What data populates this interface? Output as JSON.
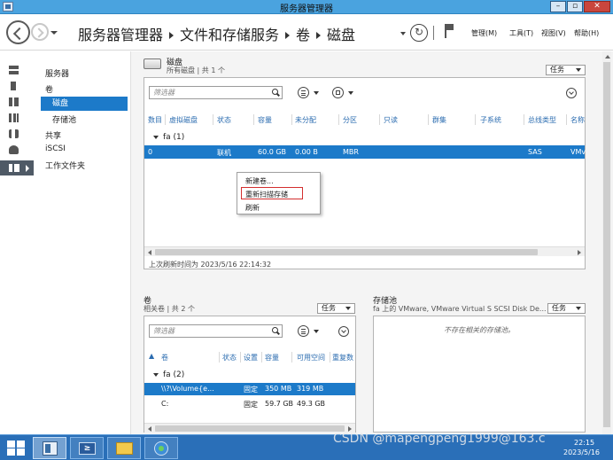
{
  "window": {
    "title": "服务器管理器",
    "min": "–",
    "max": "▫",
    "close": "✕"
  },
  "header": {
    "breadcrumb": [
      "服务器管理器",
      "文件和存储服务",
      "卷",
      "磁盘"
    ],
    "refresh": "↻",
    "menu": [
      "管理(M)",
      "工具(T)",
      "视图(V)",
      "帮助(H)"
    ]
  },
  "sidebar": {
    "items": [
      "服务器",
      "卷",
      "磁盘",
      "存储池",
      "共享",
      "iSCSI",
      "工作文件夹"
    ],
    "selected": "磁盘"
  },
  "disks": {
    "title": "磁盘",
    "subtitle": "所有磁盘 | 共 1 个",
    "tasks": "任务",
    "filter_placeholder": "筛选器",
    "columns": [
      "数目",
      "虚拟磁盘",
      "状态",
      "容量",
      "未分配",
      "分区",
      "只读",
      "群集",
      "子系统",
      "总线类型",
      "名称"
    ],
    "group": "fa (1)",
    "row": {
      "number": "0",
      "status": "联机",
      "capacity": "60.0 GB",
      "unallocated": "0.00 B",
      "partition": "MBR",
      "bus": "SAS",
      "name": "VMv"
    },
    "last_refresh": "上次刷新时间为 2023/5/16 22:14:32"
  },
  "context_menu": {
    "items": [
      "新建卷...",
      "重新扫描存储",
      "刷新"
    ],
    "highlighted": "重新扫描存储"
  },
  "volumes": {
    "title": "卷",
    "subtitle": "相关卷 | 共 2 个",
    "tasks": "任务",
    "filter_placeholder": "筛选器",
    "columns": [
      "卷",
      "状态",
      "设置",
      "容量",
      "可用空间",
      "重复数"
    ],
    "group": "fa (2)",
    "rows": [
      {
        "volume": "\\\\?\\Volume{e...",
        "setting": "固定",
        "capacity": "350 MB",
        "free": "319 MB"
      },
      {
        "volume": "C:",
        "setting": "固定",
        "capacity": "59.7 GB",
        "free": "49.3 GB"
      }
    ]
  },
  "storage_pool": {
    "title": "存储池",
    "subtitle": "fa 上的 VMware, VMware Virtual S SCSI Disk De...",
    "tasks": "任务",
    "empty": "不存在相关的存储池。"
  },
  "taskbar": {
    "powershell": "≥",
    "time": "22:15",
    "date": "2023/5/16"
  },
  "watermark": "CSDN @mapengpeng1999@163.c",
  "colors": {
    "accent": "#1c7ac9",
    "titlebar": "#4aa3df",
    "taskbar": "#2a6fb8",
    "highlight_box": "#d32f2f"
  }
}
